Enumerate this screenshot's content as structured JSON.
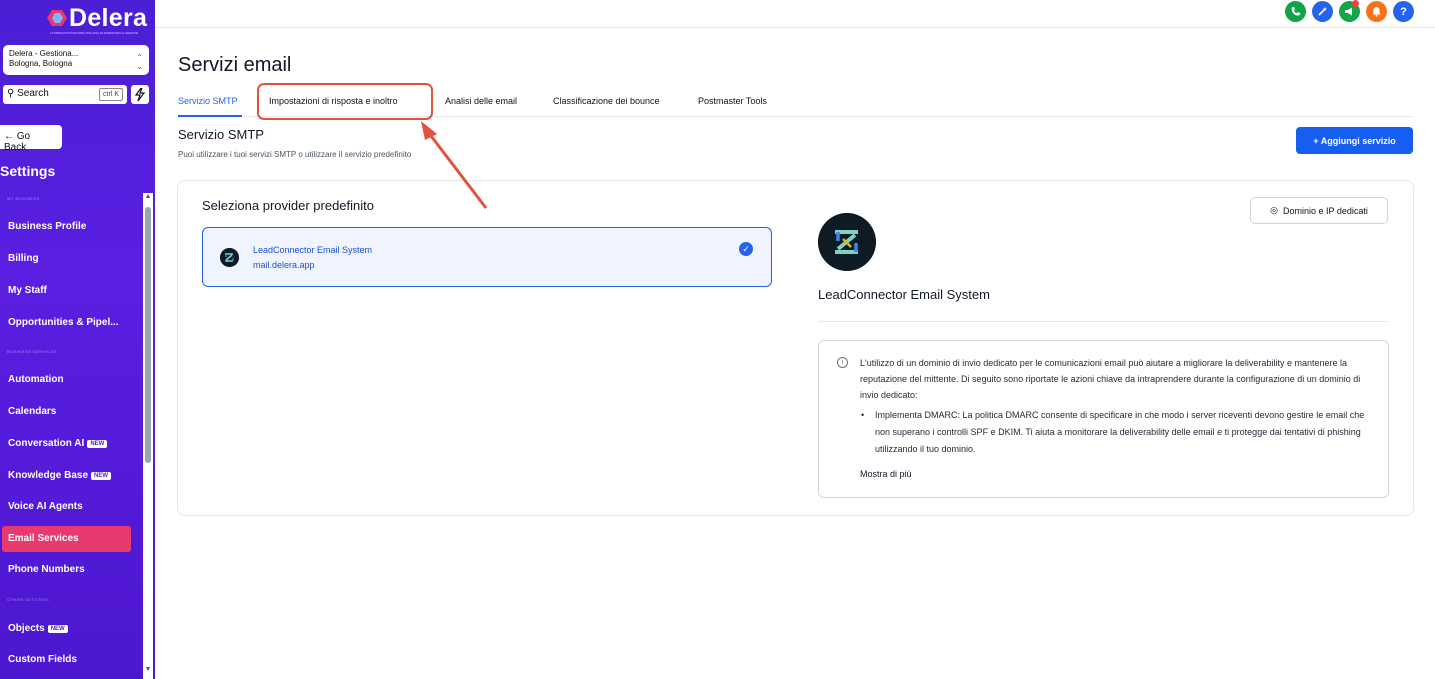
{
  "brand": {
    "name": "Delera",
    "tagline": "LA PRIMA PIATTAFORMA ITALIANA DI MARKETING E VENDITE"
  },
  "account": {
    "name": "Delera - Gestiona...",
    "location": "Bologna, Bologna"
  },
  "search": {
    "label": "Search",
    "shortcut": "ctrl K"
  },
  "sidebar": {
    "go_back": "← Go Back",
    "title": "Settings",
    "groups": [
      "MY BUSINESS",
      "BUSINESS SERVICES",
      "OTHER SETTINGS"
    ],
    "items": [
      {
        "label": "Business Profile"
      },
      {
        "label": "Billing"
      },
      {
        "label": "My Staff"
      },
      {
        "label": "Opportunities & Pipel..."
      },
      {
        "label": "Automation"
      },
      {
        "label": "Calendars"
      },
      {
        "label": "Conversation AI",
        "badge": "NEW"
      },
      {
        "label": "Knowledge Base",
        "badge": "NEW"
      },
      {
        "label": "Voice AI Agents"
      },
      {
        "label": "Email Services",
        "active": true
      },
      {
        "label": "Phone Numbers"
      },
      {
        "label": "Objects",
        "badge": "NEW"
      },
      {
        "label": "Custom Fields"
      }
    ]
  },
  "topbar": {
    "icons": [
      {
        "name": "phone-icon",
        "color": "#10a34a"
      },
      {
        "name": "magic-icon",
        "color": "#2563eb"
      },
      {
        "name": "megaphone-icon",
        "color": "#16a34a"
      },
      {
        "name": "bell-icon",
        "color": "#f97316"
      },
      {
        "name": "help-icon",
        "color": "#2563eb",
        "glyph": "?"
      }
    ]
  },
  "page": {
    "title": "Servizi email",
    "tabs": [
      {
        "label": "Servizio SMTP",
        "active": true
      },
      {
        "label": "Impostazioni di risposta e inoltro"
      },
      {
        "label": "Analisi delle email"
      },
      {
        "label": "Classificazione dei bounce"
      },
      {
        "label": "Postmaster Tools"
      }
    ],
    "section_title": "Servizio SMTP",
    "section_subtitle": "Puoi utilizzare i tuoi servizi SMTP o utilizzare il servizio predefinito",
    "add_button": "+  Aggiungi servizio"
  },
  "provider": {
    "heading": "Seleziona provider predefinito",
    "name": "LeadConnector Email System",
    "domain": "mail.delera.app",
    "dedicated_button": "Dominio e IP dedicati",
    "detail_name": "LeadConnector Email System"
  },
  "info": {
    "text": "L'utilizzo di un dominio di invio dedicato per le comunicazioni email può aiutare a migliorare la deliverability e mantenere la reputazione del mittente. Di seguito sono riportate le azioni chiave da intraprendere durante la configurazione di un dominio di invio dedicato:",
    "bullet": "Implementa DMARC: La politica DMARC consente di specificare in che modo i server riceventi devono gestire le email che non superano i controlli SPF e DKIM. Ti aiuta a monitorare la deliverability delle email e ti protegge dai tentativi di phishing utilizzando il tuo dominio.",
    "show_more": "Mostra di più"
  },
  "annotation": {
    "highlight_color": "#e0533d"
  }
}
